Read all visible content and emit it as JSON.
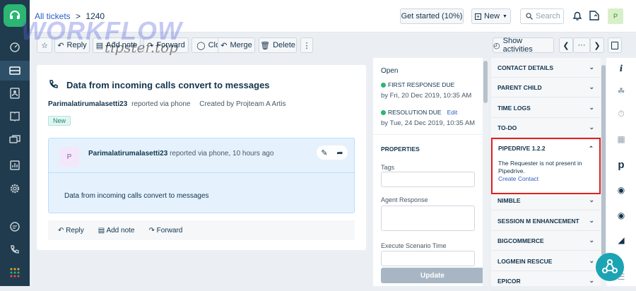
{
  "breadcrumb": {
    "link": "All tickets",
    "sep": ">",
    "current": "1240"
  },
  "header": {
    "get_started": "Get started (10%)",
    "new_label": "New",
    "search_placeholder": "Search",
    "avatar": "P"
  },
  "toolbar": {
    "reply": "Reply",
    "add_note": "Add note",
    "forward": "Forward",
    "close": "Close",
    "merge": "Merge",
    "delete": "Delete",
    "more": "⋮",
    "show_activities": "Show activities",
    "ellipsis": "···"
  },
  "ticket": {
    "title": "Data from incoming calls convert to messages",
    "requester": "Parimalatirumalasetti23",
    "reported_via": "reported via phone",
    "created_by": "Created by Projteam A Artis",
    "badge": "New"
  },
  "conversation": {
    "avatar": "P",
    "author": "Parimalatirumalasetti23",
    "meta": "reported via phone, 10 hours ago",
    "body": "Data from incoming calls convert to messages"
  },
  "conv_actions": {
    "reply": "Reply",
    "add_note": "Add note",
    "forward": "Forward"
  },
  "status": {
    "state": "Open",
    "first_response_label": "FIRST RESPONSE DUE",
    "first_response_date": "by Fri, 20 Dec 2019, 10:35 AM",
    "resolution_label": "RESOLUTION DUE",
    "edit": "Edit",
    "resolution_date": "by Tue, 24 Dec 2019, 10:35 AM",
    "properties": "PROPERTIES",
    "tags": "Tags",
    "agent_response": "Agent Response",
    "execute_scenario": "Execute Scenario Time",
    "update": "Update"
  },
  "apps": {
    "contact_details": "CONTACT DETAILS",
    "parent_child": "PARENT CHILD",
    "time_logs": "TIME LOGS",
    "todo": "TO-DO",
    "pipedrive": "PIPEDRIVE 1.2.2",
    "pipedrive_msg": "The Requester is not present in Pipedrive.",
    "create_contact": "Create Contact",
    "nimble": "NIMBLE",
    "session": "SESSION M ENHANCEMENT",
    "bigcommerce": "BIGCOMMERCE",
    "logmein": "LOGMEIN RESCUE",
    "epicor": "EPICOR"
  },
  "watermark": {
    "line1": "WORKFLOW",
    "line2": "tipster.top"
  },
  "colors": {
    "nav": "#1f3b4d",
    "brand": "#2bb673",
    "link": "#2c5cc5",
    "highlight": "#e02020",
    "chat": "#1ca4b3"
  }
}
